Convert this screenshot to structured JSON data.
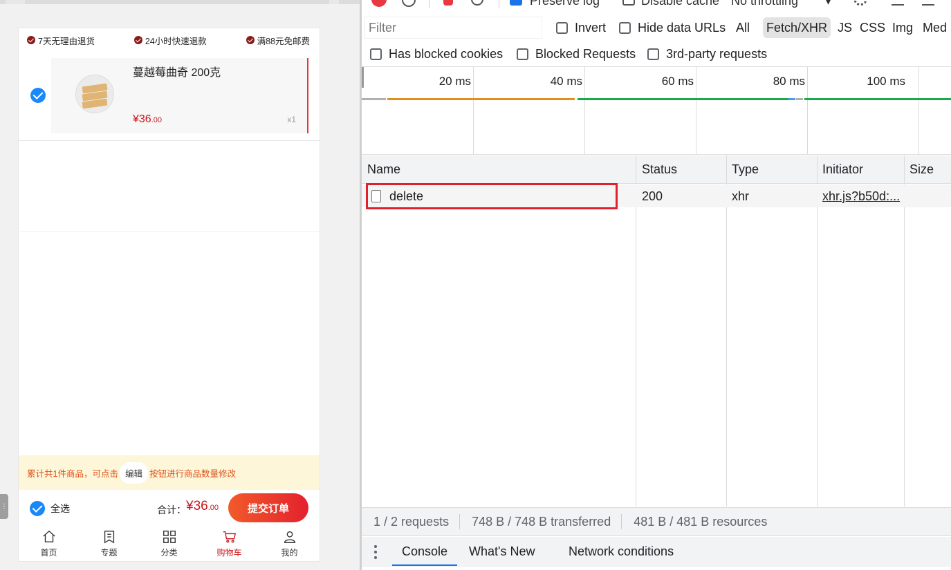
{
  "mobile": {
    "promo": [
      "7天无理由退货",
      "24小时快速退款",
      "满88元免邮费"
    ],
    "item": {
      "title": "蔓越莓曲奇 200克",
      "currency": "¥",
      "price_int": "36",
      "price_dec": ".00",
      "qty": "x1"
    },
    "tip": {
      "before": "累计共1件商品，可点击",
      "edit_label": "编辑",
      "after": "按钮进行商品数量修改"
    },
    "checkout": {
      "select_all": "全选",
      "total_label": "合计：",
      "currency": "¥",
      "total_int": "36",
      "total_dec": ".00",
      "submit": "提交订单"
    },
    "tabs": [
      {
        "label": "首页",
        "icon": "home-icon"
      },
      {
        "label": "专题",
        "icon": "topic-icon"
      },
      {
        "label": "分类",
        "icon": "category-icon"
      },
      {
        "label": "购物车",
        "icon": "cart-icon"
      },
      {
        "label": "我的",
        "icon": "user-icon"
      }
    ],
    "active_tab": 3,
    "colors": {
      "accent": "#c8161d",
      "check": "#1989fa",
      "tip_bg": "#fdf6d9"
    }
  },
  "devtools": {
    "toolbar": {
      "preserve_log": "Preserve log",
      "disable_cache": "Disable cache",
      "throttling": "No throttling"
    },
    "filter": {
      "placeholder": "Filter",
      "invert": "Invert",
      "hide_data_urls": "Hide data URLs",
      "types": [
        "All",
        "Fetch/XHR",
        "JS",
        "CSS",
        "Img",
        "Med"
      ],
      "active_type": "Fetch/XHR"
    },
    "options": {
      "has_blocked_cookies": "Has blocked cookies",
      "blocked_requests": "Blocked Requests",
      "third_party": "3rd-party requests"
    },
    "timeline": {
      "ticks": [
        "20 ms",
        "40 ms",
        "60 ms",
        "80 ms",
        "100 ms"
      ]
    },
    "columns": {
      "name": "Name",
      "status": "Status",
      "type": "Type",
      "initiator": "Initiator",
      "size": "Size"
    },
    "requests": [
      {
        "name": "delete",
        "status": "200",
        "type": "xhr",
        "initiator": "xhr.js?b50d:...",
        "size": ""
      }
    ],
    "summary": {
      "requests": "1 / 2 requests",
      "transferred": "748 B / 748 B transferred",
      "resources": "481 B / 481 B resources"
    },
    "drawer_tabs": [
      "Console",
      "What's New",
      "Network conditions"
    ],
    "colors": {
      "highlight": "#e0212c",
      "record": "#e9383f",
      "accent": "#1a73e8"
    }
  }
}
